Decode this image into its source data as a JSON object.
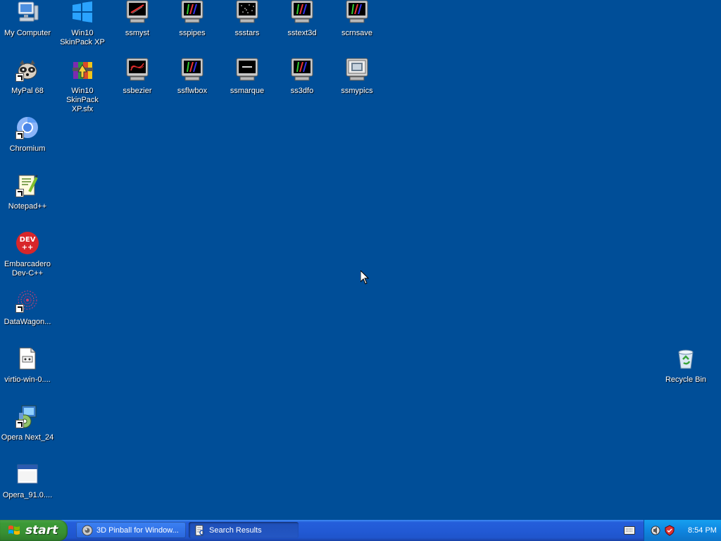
{
  "desktop": {
    "icons": [
      {
        "label": "My Computer"
      },
      {
        "label": "Win10 SkinPack XP"
      },
      {
        "label": "ssmyst"
      },
      {
        "label": "sspipes"
      },
      {
        "label": "ssstars"
      },
      {
        "label": "sstext3d"
      },
      {
        "label": "scrnsave"
      },
      {
        "label": "MyPal 68"
      },
      {
        "label": "Win10 SkinPack XP.sfx"
      },
      {
        "label": "ssbezier"
      },
      {
        "label": "ssflwbox"
      },
      {
        "label": "ssmarque"
      },
      {
        "label": "ss3dfo"
      },
      {
        "label": "ssmypics"
      },
      {
        "label": "Chromium"
      },
      {
        "label": "Notepad++"
      },
      {
        "label": "Embarcadero Dev-C++"
      },
      {
        "label": "DataWagon..."
      },
      {
        "label": "virtio-win-0...."
      },
      {
        "label": "Opera Next_24"
      },
      {
        "label": "Opera_91.0...."
      },
      {
        "label": "Recycle Bin"
      }
    ]
  },
  "taskbar": {
    "start_label": "start",
    "tasks": [
      {
        "label": "3D Pinball for Window..."
      },
      {
        "label": "Search Results"
      }
    ],
    "clock": "8:54 PM"
  },
  "colors": {
    "desktop_bg": "#004e98",
    "taskbar_blue": "#245edb",
    "start_green": "#3c9a37"
  }
}
